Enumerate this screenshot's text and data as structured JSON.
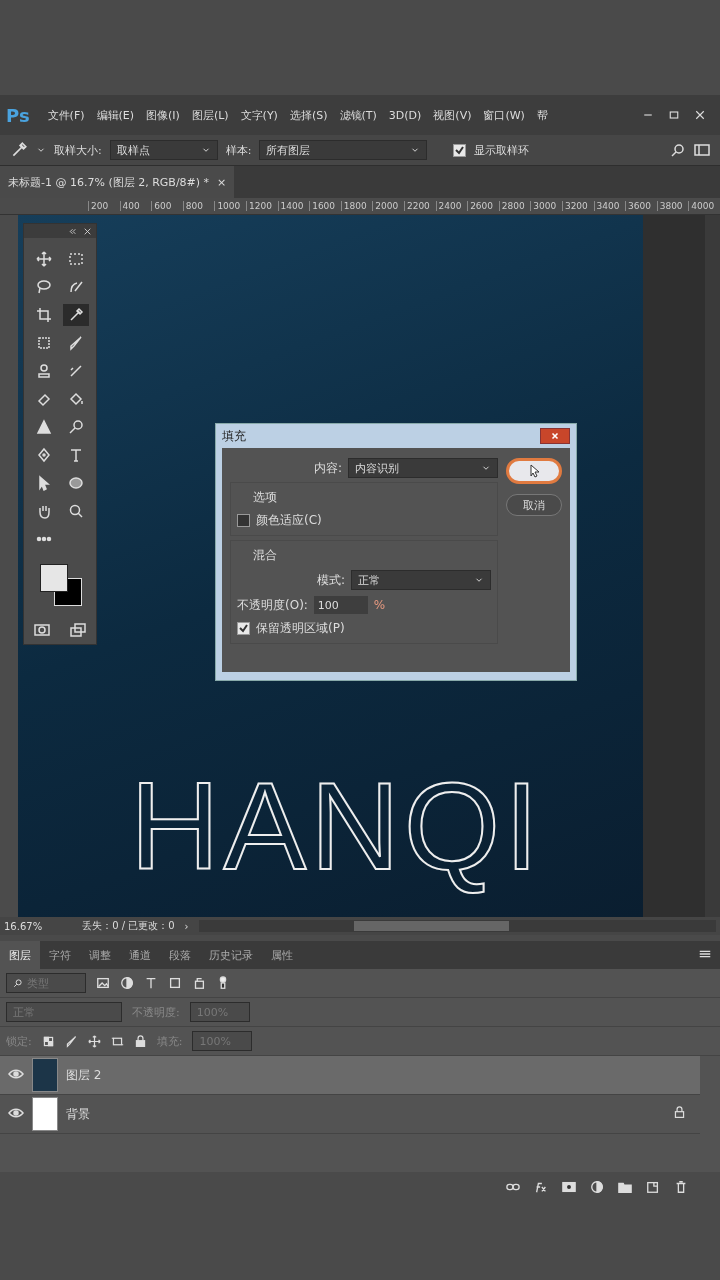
{
  "menu_bar": {
    "logo": "Ps",
    "items": [
      "文件(F)",
      "编辑(E)",
      "图像(I)",
      "图层(L)",
      "文字(Y)",
      "选择(S)",
      "滤镜(T)",
      "3D(D)",
      "视图(V)",
      "窗口(W)",
      "帮"
    ]
  },
  "options_bar": {
    "sample_size_label": "取样大小:",
    "sample_size": "取样点",
    "sample_label": "样本:",
    "sample": "所有图层",
    "show_ring": {
      "label": "显示取样环",
      "checked": true
    }
  },
  "document_tab": {
    "title": "未标题-1 @ 16.7% (图层 2, RGB/8#) *",
    "close": "×"
  },
  "ruler": [
    "200",
    "400",
    "600",
    "800",
    "1000",
    "1200",
    "1400",
    "1600",
    "1800",
    "2000",
    "2200",
    "2400",
    "2600",
    "2800",
    "3000",
    "3200",
    "3400",
    "3600",
    "3800",
    "4000"
  ],
  "toolbox": {
    "tools": [
      {
        "selected": false
      },
      {
        "selected": false
      },
      {
        "selected": false
      },
      {
        "selected": false
      },
      {
        "selected": false
      },
      {
        "selected": true
      },
      {
        "selected": false
      },
      {
        "selected": false
      },
      {
        "selected": false
      },
      {
        "selected": false
      },
      {
        "selected": false
      },
      {
        "selected": false
      },
      {
        "selected": false
      },
      {
        "selected": false
      },
      {
        "selected": false
      },
      {
        "selected": false
      },
      {
        "selected": false
      },
      {
        "selected": false
      },
      {
        "selected": false
      },
      {
        "selected": false
      }
    ]
  },
  "canvas": {
    "selection_text": "HANQI"
  },
  "fill_dialog": {
    "title": "填充",
    "contents_label": "内容:",
    "contents": "内容识别",
    "cancel": "取消",
    "options_group": "选项",
    "color_adaptation": {
      "label": "颜色适应(C)",
      "checked": false
    },
    "blending_group": "混合",
    "mode_label": "模式:",
    "mode": "正常",
    "opacity_label": "不透明度(O):",
    "opacity": "100",
    "percent": "%",
    "preserve_transparency": {
      "label": "保留透明区域(P)",
      "checked": true
    }
  },
  "status_bar": {
    "zoom": "16.67%",
    "info": "丢失：0 / 已更改：0",
    "arrow": "›"
  },
  "layers_panel": {
    "tabs": [
      {
        "label": "图层",
        "selected": true
      },
      {
        "label": "字符",
        "selected": false
      },
      {
        "label": "调整",
        "selected": false
      },
      {
        "label": "通道",
        "selected": false
      },
      {
        "label": "段落",
        "selected": false
      },
      {
        "label": "历史记录",
        "selected": false
      },
      {
        "label": "属性",
        "selected": false
      }
    ],
    "filter_placeholder": "类型",
    "blend_mode": "正常",
    "opacity_label": "不透明度:",
    "opacity": "100%",
    "lock_label": "锁定:",
    "fill_label": "填充:",
    "fill": "100%",
    "layers": [
      {
        "name": "图层 2",
        "kind": "photo",
        "selected": true,
        "visible": true,
        "locked": false
      },
      {
        "name": "背景",
        "kind": "white",
        "selected": false,
        "visible": true,
        "locked": true
      }
    ]
  }
}
